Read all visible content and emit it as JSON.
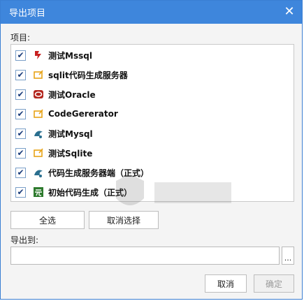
{
  "window": {
    "title": "导出项目",
    "close_glyph": "✕"
  },
  "items_label": "项目:",
  "items": [
    {
      "label": "测试Mssql",
      "icon": "mssql-icon",
      "checked": true
    },
    {
      "label": "sqlit代码生成服务器",
      "icon": "folder-icon",
      "checked": true
    },
    {
      "label": "测试Oracle",
      "icon": "oracle-icon",
      "checked": true
    },
    {
      "label": "CodeGererator",
      "icon": "folder-icon",
      "checked": true
    },
    {
      "label": "测试Mysql",
      "icon": "mysql-icon",
      "checked": true
    },
    {
      "label": "测试Sqlite",
      "icon": "folder-icon",
      "checked": true
    },
    {
      "label": "代码生成服务器端（正式）",
      "icon": "mysql-icon",
      "checked": true
    },
    {
      "label": "初始代码生成（正式）",
      "icon": "wu-icon",
      "checked": true
    }
  ],
  "check_glyph": "✔",
  "buttons": {
    "select_all": "全选",
    "unselect": "取消选择",
    "cancel": "取消",
    "ok": "确定",
    "browse": "..."
  },
  "export_label": "导出到:",
  "export_path": {
    "value": "",
    "placeholder": ""
  },
  "colors": {
    "titlebar": "#3e86dc",
    "mssql": "#c82020",
    "folder": "#e8a317",
    "oracle": "#b3261e",
    "mysql": "#2a6f8f",
    "wu": "#2d7a2d"
  }
}
